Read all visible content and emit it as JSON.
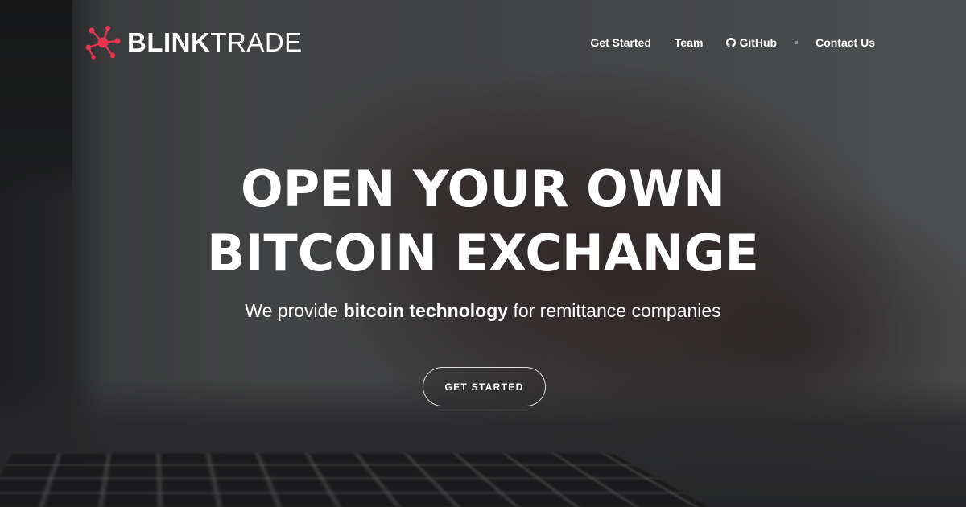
{
  "brand": {
    "name_bold": "BLINK",
    "name_light": "TRADE",
    "accent_color": "#e8344e",
    "logo_icon": "network-nodes-icon"
  },
  "nav": {
    "items": [
      {
        "label": "Get Started"
      },
      {
        "label": "Team"
      },
      {
        "label": "GitHub",
        "icon": "github-icon"
      },
      {
        "label": "Contact Us"
      }
    ]
  },
  "hero": {
    "title_line_1": "OPEN YOUR OWN",
    "title_line_2": "BITCOIN EXCHANGE",
    "subtitle_prefix": "We provide ",
    "subtitle_bold": "bitcoin technology",
    "subtitle_suffix": " for remittance companies",
    "cta_label": "GET STARTED"
  },
  "background": {
    "description_image": "blurred-hand-typing-on-keyboard"
  }
}
